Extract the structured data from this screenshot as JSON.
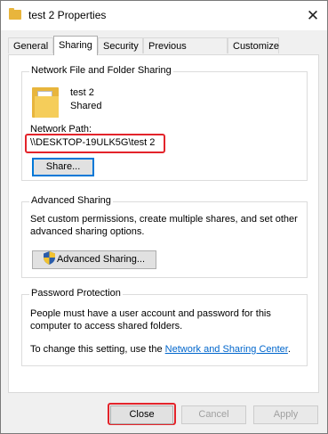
{
  "window": {
    "title": "test 2 Properties",
    "close_glyph": "✕"
  },
  "tabs": [
    {
      "label": "General"
    },
    {
      "label": "Sharing"
    },
    {
      "label": "Security"
    },
    {
      "label": "Previous Versions"
    },
    {
      "label": "Customize"
    }
  ],
  "network_sharing": {
    "group_title": "Network File and Folder Sharing",
    "folder_name": "test 2",
    "folder_status": "Shared",
    "path_label": "Network Path:",
    "path_value": "\\\\DESKTOP-19ULK5G\\test 2",
    "share_button": "Share..."
  },
  "advanced_sharing": {
    "group_title": "Advanced Sharing",
    "description_line1": "Set custom permissions, create multiple shares, and set other",
    "description_line2": "advanced sharing options.",
    "button": "Advanced Sharing..."
  },
  "password_protection": {
    "group_title": "Password Protection",
    "description_line1": "People must have a user account and password for this",
    "description_line2": "computer to access shared folders.",
    "change_text": "To change this setting, use the",
    "link_text": "Network and Sharing Center",
    "link_suffix": "."
  },
  "footer": {
    "close": "Close",
    "cancel": "Cancel",
    "apply": "Apply"
  },
  "colors": {
    "highlight": "#e3242b",
    "link": "#0066cc",
    "folder": "#e8b53c"
  },
  "icons": {
    "title": "folder-icon",
    "large": "folder-icon",
    "uac": "uac-shield-icon",
    "close": "close-icon"
  }
}
